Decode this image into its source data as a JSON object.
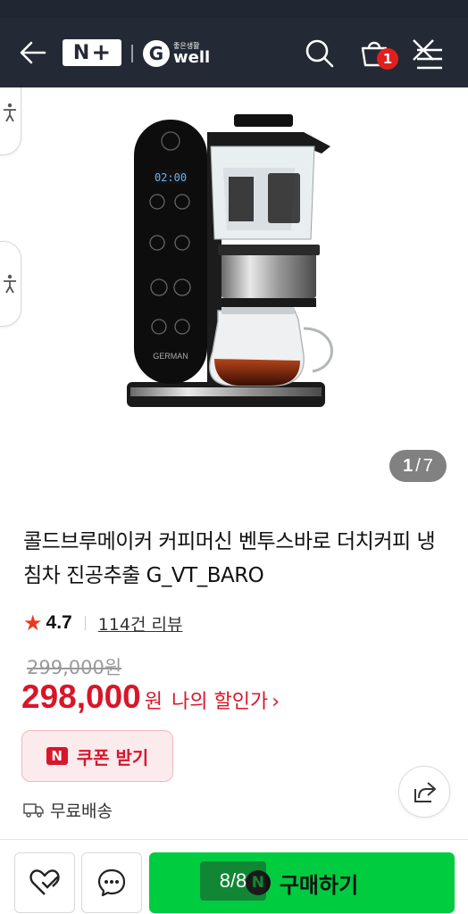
{
  "header": {
    "logo_np_left": "N",
    "logo_np_right": "+",
    "logo_gw_letter": "G",
    "logo_gw_sub": "좋은생활",
    "logo_gw_word": "well",
    "cart_count": "1",
    "icons": [
      "back-arrow-icon",
      "search-icon",
      "cart-icon",
      "menu-icon",
      "close-icon"
    ]
  },
  "gallery": {
    "current": "1",
    "separator": "/",
    "total": "7",
    "brand_text": "GERMAN",
    "display_time": "02:00"
  },
  "product": {
    "title": "콜드브루메이커 커피머신 벤투스바로 더치커피 냉침차 진공추출 G_VT_BARO",
    "star": "★",
    "rating": "4.7",
    "review_link": "114건 리뷰",
    "original_price": "299,000원",
    "price": "298,000",
    "currency": "원",
    "discount_label": "나의 할인가",
    "discount_arrow": "›"
  },
  "coupon": {
    "icon_letter": "N",
    "label": "쿠폰 받기"
  },
  "shipping": {
    "label": "무료배송"
  },
  "bottom_bar": {
    "buy_icon_letter": "N",
    "buy_label": "구매하기",
    "page_indicator": "8/8"
  },
  "colors": {
    "header_bg": "#232a35",
    "price_red": "#d8162a",
    "buy_green": "#00cc40",
    "star_red": "#e83a1f"
  }
}
